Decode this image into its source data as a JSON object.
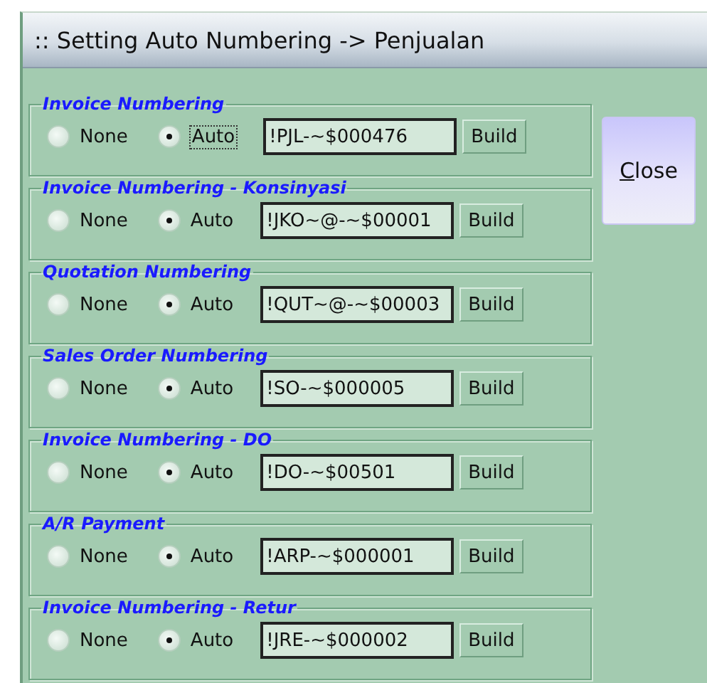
{
  "window": {
    "title": ":: Setting Auto Numbering -> Penjualan"
  },
  "groups": [
    {
      "title": "Invoice Numbering",
      "options": [
        {
          "label": "None",
          "selected": false,
          "focused": false
        },
        {
          "label": "Auto",
          "selected": true,
          "focused": true
        }
      ],
      "code": "!PJL-~$000476",
      "button": "Build"
    },
    {
      "title": "Invoice Numbering - Konsinyasi",
      "options": [
        {
          "label": "None",
          "selected": false,
          "focused": false
        },
        {
          "label": "Auto",
          "selected": true,
          "focused": false
        }
      ],
      "code": "!JKO~@-~$00001",
      "button": "Build"
    },
    {
      "title": "Quotation Numbering",
      "options": [
        {
          "label": "None",
          "selected": false,
          "focused": false
        },
        {
          "label": "Auto",
          "selected": true,
          "focused": false
        }
      ],
      "code": "!QUT~@-~$00003",
      "button": "Build"
    },
    {
      "title": "Sales Order Numbering",
      "options": [
        {
          "label": "None",
          "selected": false,
          "focused": false
        },
        {
          "label": "Auto",
          "selected": true,
          "focused": false
        }
      ],
      "code": "!SO-~$000005",
      "button": "Build"
    },
    {
      "title": "Invoice Numbering - DO",
      "options": [
        {
          "label": "None",
          "selected": false,
          "focused": false
        },
        {
          "label": "Auto",
          "selected": true,
          "focused": false
        }
      ],
      "code": "!DO-~$00501",
      "button": "Build"
    },
    {
      "title": "A/R Payment",
      "options": [
        {
          "label": "None",
          "selected": false,
          "focused": false
        },
        {
          "label": "Auto",
          "selected": true,
          "focused": false
        }
      ],
      "code": "!ARP-~$000001",
      "button": "Build"
    },
    {
      "title": "Invoice Numbering - Retur",
      "options": [
        {
          "label": "None",
          "selected": false,
          "focused": false
        },
        {
          "label": "Auto",
          "selected": true,
          "focused": false
        }
      ],
      "code": "!JRE-~$000002",
      "button": "Build"
    }
  ],
  "close_button": {
    "label": "Close",
    "mnemonic_underline": true
  }
}
